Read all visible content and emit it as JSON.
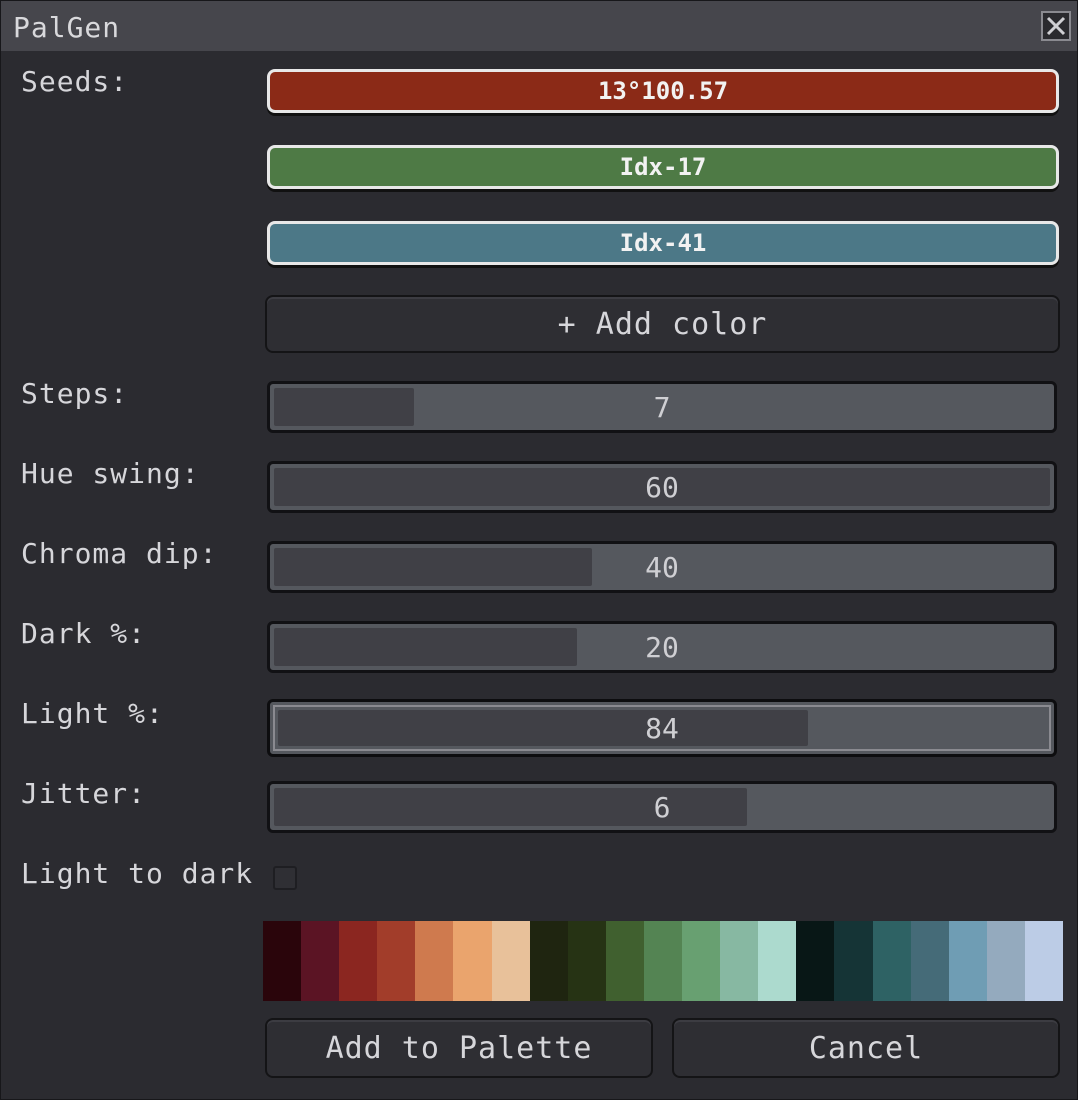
{
  "window": {
    "title": "PalGen"
  },
  "labels": {
    "seeds": "Seeds:",
    "steps": "Steps:",
    "hue_swing": "Hue swing:",
    "chroma_dip": "Chroma dip:",
    "dark": "Dark %:",
    "light": "Light %:",
    "jitter": "Jitter:",
    "light_to_dark": "Light to dark"
  },
  "seeds": [
    {
      "label": "13°100.57",
      "color": "#8b2a17"
    },
    {
      "label": "Idx-17",
      "color": "#4e7a45"
    },
    {
      "label": "Idx-41",
      "color": "#4c7887"
    }
  ],
  "add_color_label": "+ Add color",
  "sliders": {
    "steps": {
      "value": "7",
      "fraction": 0.18
    },
    "hue_swing": {
      "value": "60",
      "fraction": 1.0
    },
    "chroma_dip": {
      "value": "40",
      "fraction": 0.41
    },
    "dark": {
      "value": "20",
      "fraction": 0.39
    },
    "light": {
      "value": "84",
      "fraction": 0.69
    },
    "jitter": {
      "value": "6",
      "fraction": 0.61
    }
  },
  "light_to_dark_checked": false,
  "palette": [
    "#2a050b",
    "#5b1424",
    "#8b2620",
    "#a23d2a",
    "#cf7a4e",
    "#eaa46d",
    "#e8c19a",
    "#1f2510",
    "#263314",
    "#40602f",
    "#548453",
    "#68a071",
    "#87b8a2",
    "#acdace",
    "#081716",
    "#153436",
    "#2e6264",
    "#456b78",
    "#6f9db4",
    "#94aabe",
    "#bccce6"
  ],
  "buttons": {
    "add_to_palette": "Add to Palette",
    "cancel": "Cancel"
  },
  "colors": {
    "background": "#2b2b30",
    "titlebar": "#46464c",
    "slider_track": "#55585e",
    "slider_fill": "#404046"
  }
}
